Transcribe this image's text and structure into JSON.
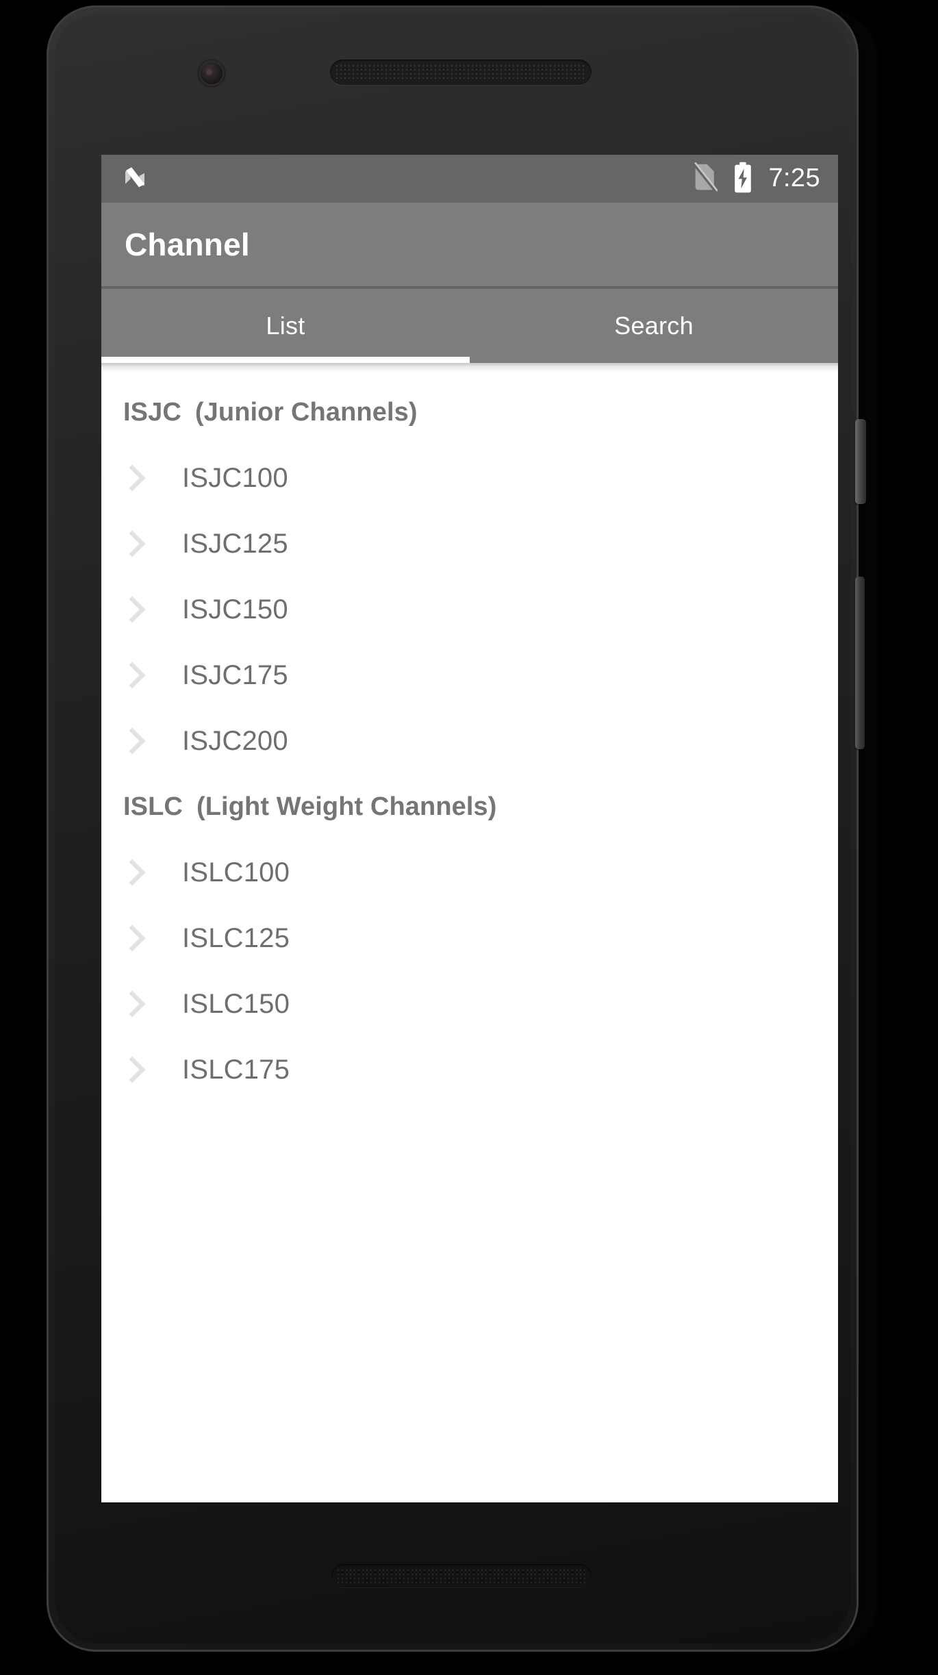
{
  "device": {
    "frame": "android-phone",
    "hardware": {
      "camera": "front-camera",
      "earpiece": "earpiece-speaker",
      "bottom_speaker": "bottom-speaker",
      "power_button": "power-button",
      "volume_button": "volume-rocker"
    }
  },
  "statusbar": {
    "left_icon": "android-nougat-icon",
    "sim_icon": "no-sim-card-icon",
    "battery_icon": "battery-charging-icon",
    "time": "7:25",
    "background": "#666666"
  },
  "appbar": {
    "title": "Channel",
    "background": "#7d7d7d",
    "text_color": "#ffffff"
  },
  "tabs": {
    "background": "#7d7d7d",
    "indicator_color": "#ffffff",
    "active_index": 0,
    "items": [
      {
        "label": "List"
      },
      {
        "label": "Search"
      }
    ]
  },
  "list": {
    "background": "#ffffff",
    "header_color": "#757575",
    "row_color": "#6e6e6e",
    "chevron_icon": "chevron-right-icon",
    "chevron_color": "#e0e0e0",
    "groups": [
      {
        "code": "ISJC",
        "description": "(Junior Channels)",
        "items": [
          {
            "label": "ISJC100"
          },
          {
            "label": "ISJC125"
          },
          {
            "label": "ISJC150"
          },
          {
            "label": "ISJC175"
          },
          {
            "label": "ISJC200"
          }
        ]
      },
      {
        "code": "ISLC",
        "description": "(Light Weight Channels)",
        "items": [
          {
            "label": "ISLC100"
          },
          {
            "label": "ISLC125"
          },
          {
            "label": "ISLC150"
          },
          {
            "label": "ISLC175"
          }
        ]
      }
    ]
  },
  "navbar": {
    "background": "#000000",
    "buttons": [
      {
        "name": "back-icon"
      },
      {
        "name": "home-icon"
      },
      {
        "name": "recents-icon"
      }
    ]
  }
}
